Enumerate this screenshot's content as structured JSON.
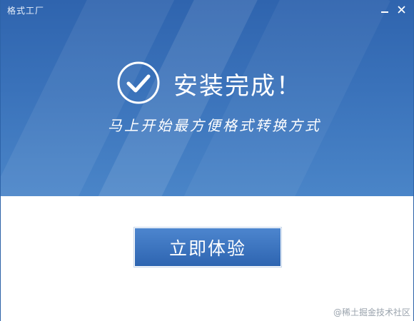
{
  "window": {
    "title": "格式工厂",
    "minimize_icon": "minimize-icon",
    "close_icon": "close-icon"
  },
  "hero": {
    "status_icon": "check-circle-icon",
    "headline": "安装完成！",
    "subline": "马上开始最方便格式转换方式"
  },
  "actions": {
    "primary_label": "立即体验"
  },
  "watermark": "@稀土掘金技术社区",
  "colors": {
    "hero_top": "#2f64ae",
    "hero_bottom": "#4a85c8",
    "button": "#3a72c0",
    "text_on_blue": "#ffffff"
  }
}
